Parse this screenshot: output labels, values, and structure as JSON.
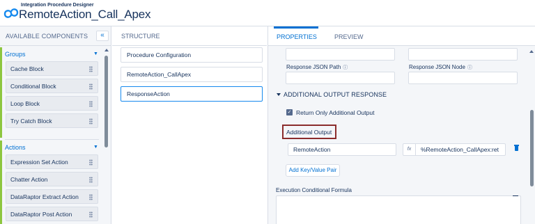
{
  "header": {
    "subtitle": "Integration Procedure Designer",
    "title": "RemoteAction_Call_Apex"
  },
  "left_panel": {
    "title": "AVAILABLE COMPONENTS",
    "collapse_label": "«",
    "groups": [
      {
        "label": "Groups",
        "items": [
          "Cache Block",
          "Conditional Block",
          "Loop Block",
          "Try Catch Block"
        ]
      },
      {
        "label": "Actions",
        "items": [
          "Expression Set Action",
          "Chatter Action",
          "DataRaptor Extract Action",
          "DataRaptor Post Action"
        ]
      }
    ]
  },
  "structure": {
    "title": "STRUCTURE",
    "items": [
      "Procedure Configuration",
      "RemoteAction_CallApex",
      "ResponseAction"
    ],
    "selected_index": 2
  },
  "properties": {
    "tabs": [
      "PROPERTIES",
      "PREVIEW"
    ],
    "active_tab": 0,
    "response_json_path_label": "Response JSON Path",
    "response_json_node_label": "Response JSON Node",
    "info_icon": "ⓘ",
    "section_title": "ADDITIONAL OUTPUT RESPONSE",
    "return_only_label": "Return Only Additional Output",
    "return_only_checked": true,
    "additional_output_label": "Additional Output",
    "kv_key": "RemoteAction",
    "fx_label": "fx",
    "kv_value": "%RemoteAction_CallApex:ret",
    "add_pair_label": "Add Key/Value Pair",
    "exec_formula_label": "Execution Conditional Formula"
  },
  "colors": {
    "brand": "#0070d2",
    "group_bar": "#8dc63f",
    "highlight": "#8b2c2c"
  }
}
